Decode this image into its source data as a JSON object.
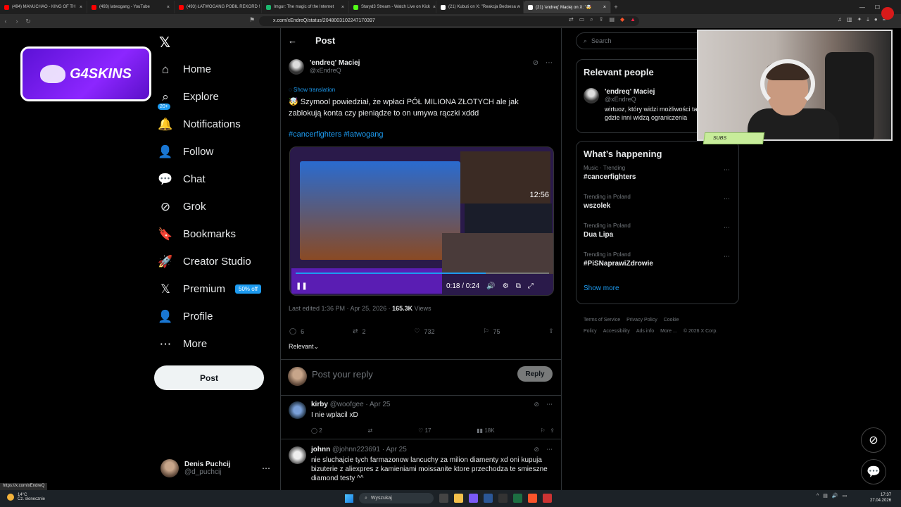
{
  "browser": {
    "tabs": [
      {
        "label": "(494) MANUCHAO - KING OF TH",
        "color": "#ff0000",
        "active": false
      },
      {
        "label": "(493) latwogang - YouTube",
        "color": "#ff0000",
        "active": false
      },
      {
        "label": "(493) ŁATWOGANG POBIŁ REKORD !",
        "color": "#ff0000",
        "active": false
      },
      {
        "label": "Imgur: The magic of the Internet",
        "color": "#1bb76e",
        "active": false
      },
      {
        "label": "Staryd3 Stream - Watch Live on Kick",
        "color": "#53fc18",
        "active": false
      },
      {
        "label": "(21) Kubuś on X: \"Reakcja Bedoesa w",
        "color": "#ffffff",
        "active": false
      },
      {
        "label": "(21) 'endreq' Maciej on X: \"🤯",
        "color": "#ffffff",
        "active": true
      }
    ],
    "new_tab": "+",
    "url": "x.com/xEndreQ/status/2048003102247170397",
    "status_url": "https://x.com/xEndreQ"
  },
  "sponsor": {
    "text": "G4SKINS"
  },
  "nav": {
    "items": [
      {
        "label": "Home",
        "icon": "home-icon",
        "glyph": "⌂"
      },
      {
        "label": "Explore",
        "icon": "search-icon",
        "glyph": "⌕"
      },
      {
        "label": "Notifications",
        "icon": "bell-icon",
        "glyph": "🔔",
        "badge": "20+"
      },
      {
        "label": "Follow",
        "icon": "person-add-icon",
        "glyph": "👤"
      },
      {
        "label": "Chat",
        "icon": "chat-icon",
        "glyph": "💬"
      },
      {
        "label": "Grok",
        "icon": "grok-icon",
        "glyph": "⊘"
      },
      {
        "label": "Bookmarks",
        "icon": "bookmark-icon",
        "glyph": "🔖"
      },
      {
        "label": "Creator Studio",
        "icon": "rocket-icon",
        "glyph": "🚀"
      },
      {
        "label": "Premium",
        "icon": "x-logo-icon",
        "glyph": "𝕏",
        "pill": "50% off"
      },
      {
        "label": "Profile",
        "icon": "profile-icon",
        "glyph": "👤"
      },
      {
        "label": "More",
        "icon": "more-circle-icon",
        "glyph": "⋯"
      }
    ],
    "post_button": "Post",
    "account": {
      "name": "Denis Puchcij",
      "handle": "@d_puchcij",
      "more": "⋯"
    }
  },
  "post": {
    "header": "Post",
    "back": "←",
    "author_name": "'endreq' Maciej",
    "author_handle": "@xEndreQ",
    "show_translation": "Show translation",
    "text": "🤯 Szymool powiedział, że wpłaci PÓŁ MILIONA ZŁOTYCH ale jak zablokują konta czy pieniądze to on umywa rączki xddd",
    "hashtags": "#cancerfighters #latwogang",
    "video": {
      "remaining": "12:56",
      "timecode": "0:18 / 0:24",
      "progress": 0.75
    },
    "meta_prefix": "Last edited 1:36 PM · Apr 25, 2026 · ",
    "views_count": "165.3K",
    "views_label": "Views",
    "stats": {
      "replies": "6",
      "reposts": "2",
      "likes": "732",
      "bookmarks": "75"
    },
    "relevant": "Relevant",
    "reply_placeholder": "Post your reply",
    "reply_button": "Reply"
  },
  "comments": [
    {
      "name": "kirby",
      "handle": "@woofgee · Apr 25",
      "text": "I nie wplacil xD",
      "replies": "2",
      "likes": "17",
      "views": "18K"
    },
    {
      "name": "johnn",
      "handle": "@johnn223691 · Apr 25",
      "text": "nie sluchajcie tych farmazonow lancuchy za milion diamenty xd oni kupuja bizuterie z aliexpres z kamieniami moissanite  ktore przechodza te smieszne diamond testy ^^"
    }
  ],
  "sidebar": {
    "search_placeholder": "Search",
    "relevant_title": "Relevant people",
    "person": {
      "name": "'endreq' Maciej",
      "handle": "@xEndreQ",
      "bio": "wirtuoz, który widzi możliwości tam, gdzie inni widzą ograniczenia"
    },
    "happening_title": "What’s happening",
    "trends": [
      {
        "context": "Music · Trending",
        "name": "#cancerfighters"
      },
      {
        "context": "Trending in Poland",
        "name": "wszolek"
      },
      {
        "context": "Trending in Poland",
        "name": "Dua Lipa"
      },
      {
        "context": "Trending in Poland",
        "name": "#PiSNaprawiZdrowie"
      }
    ],
    "show_more": "Show more",
    "footer": [
      "Terms of Service",
      "Privacy Policy",
      "Cookie Policy",
      "Accessibility",
      "Ads info",
      "More ...",
      "© 2026 X Corp."
    ]
  },
  "overlay": {
    "subs_label": "SUBS"
  },
  "taskbar": {
    "weather_temp": "14°C",
    "weather_desc": "Cz. słonecznie",
    "search": "Wyszukaj",
    "time": "17:37",
    "date": "27.04.2026"
  }
}
